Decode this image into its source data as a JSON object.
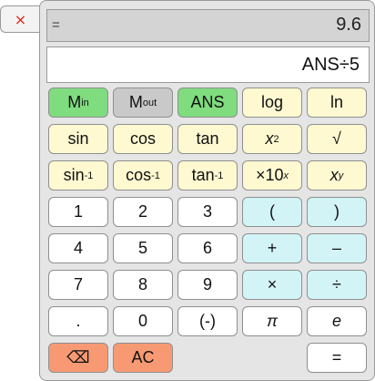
{
  "close_symbol": "×",
  "display": {
    "equals_sign": "=",
    "result": "9.6",
    "expression": "ANS÷5"
  },
  "buttons": {
    "m_in": {
      "main": "M",
      "sub": "in"
    },
    "m_out": {
      "main": "M",
      "sub": "out"
    },
    "ans": "ANS",
    "log": "log",
    "ln": "ln",
    "sin": "sin",
    "cos": "cos",
    "tan": "tan",
    "square": {
      "base": "x",
      "sup": "2"
    },
    "sqrt": "√",
    "asin": {
      "base": "sin",
      "sup": "-1"
    },
    "acos": {
      "base": "cos",
      "sup": "-1"
    },
    "atan": {
      "base": "tan",
      "sup": "-1"
    },
    "times_ten": {
      "base": "×10",
      "sup": "x"
    },
    "power": {
      "base": "x",
      "sup": "y"
    },
    "d1": "1",
    "d2": "2",
    "d3": "3",
    "lparen": "(",
    "rparen": ")",
    "d4": "4",
    "d5": "5",
    "d6": "6",
    "plus": "+",
    "minus": "–",
    "d7": "7",
    "d8": "8",
    "d9": "9",
    "times": "×",
    "divide": "÷",
    "dot": ".",
    "d0": "0",
    "negate": "(-)",
    "pi": "π",
    "e": "e",
    "backspace": "⌫",
    "ac": "AC",
    "equals": "="
  },
  "colors": {
    "memory_green": "#7fdc7f",
    "memory_grey": "#c9c9c9",
    "function_cream": "#fff9d1",
    "operator_cyan": "#d3f4f7",
    "clear_red": "#f79a74",
    "digit_white": "#ffffff"
  }
}
